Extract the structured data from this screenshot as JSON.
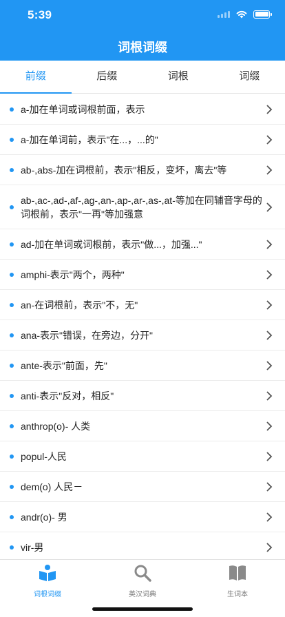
{
  "status": {
    "time": "5:39"
  },
  "header": {
    "title": "词根词缀"
  },
  "tabs": [
    {
      "label": "前缀",
      "active": true
    },
    {
      "label": "后缀",
      "active": false
    },
    {
      "label": "词根",
      "active": false
    },
    {
      "label": "词缀",
      "active": false
    }
  ],
  "list": [
    "a-加在单词或词根前面，表示",
    "a-加在单词前，表示\"在...，...的\"",
    "ab-,abs-加在词根前，表示\"相反，变坏，离去\"等",
    "ab-,ac-,ad-,af-,ag-,an-,ap-,ar-,as-,at-等加在同辅音字母的词根前，表示\"一再\"等加强意",
    "ad-加在单词或词根前，表示\"做...，加强...\"",
    "amphi-表示\"两个，两种\"",
    "an-在词根前，表示\"不，无\"",
    "ana-表示\"错误，在旁边，分开\"",
    "ante-表示\"前面，先\"",
    "anti-表示\"反对，相反\"",
    "anthrop(o)- 人类",
    "popul-人民",
    "dem(o) 人民－",
    "andr(o)- 男",
    "vir-男"
  ],
  "tabbar": [
    {
      "label": "词根词缀",
      "icon": "book-reader-icon",
      "active": true
    },
    {
      "label": "英汉词典",
      "icon": "search-icon",
      "active": false
    },
    {
      "label": "生词本",
      "icon": "open-book-icon",
      "active": false
    }
  ],
  "colors": {
    "primary": "#2196f3",
    "inactive_icon": "#8a8a8a"
  }
}
